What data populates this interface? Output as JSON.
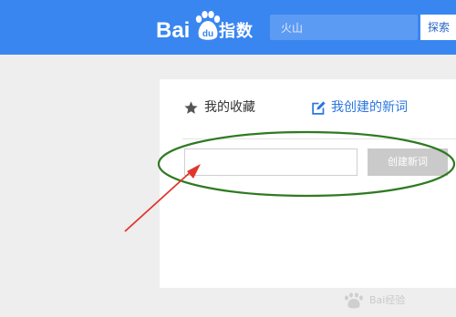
{
  "header": {
    "logo_text_bai": "Bai",
    "logo_text_du": "du",
    "logo_text_zhishu": "指数",
    "search_value": "火山",
    "search_button_label": "探索",
    "bar_color": "#3a86f0"
  },
  "tabs": {
    "favorites_label": "我的收藏",
    "favorites_icon": "star-icon",
    "created_label": "我创建的新词",
    "created_icon": "edit-icon"
  },
  "form": {
    "word_input_value": "",
    "create_button_label": "创建新词"
  },
  "watermark": {
    "text": "Bai经验",
    "icon": "paw-icon"
  }
}
